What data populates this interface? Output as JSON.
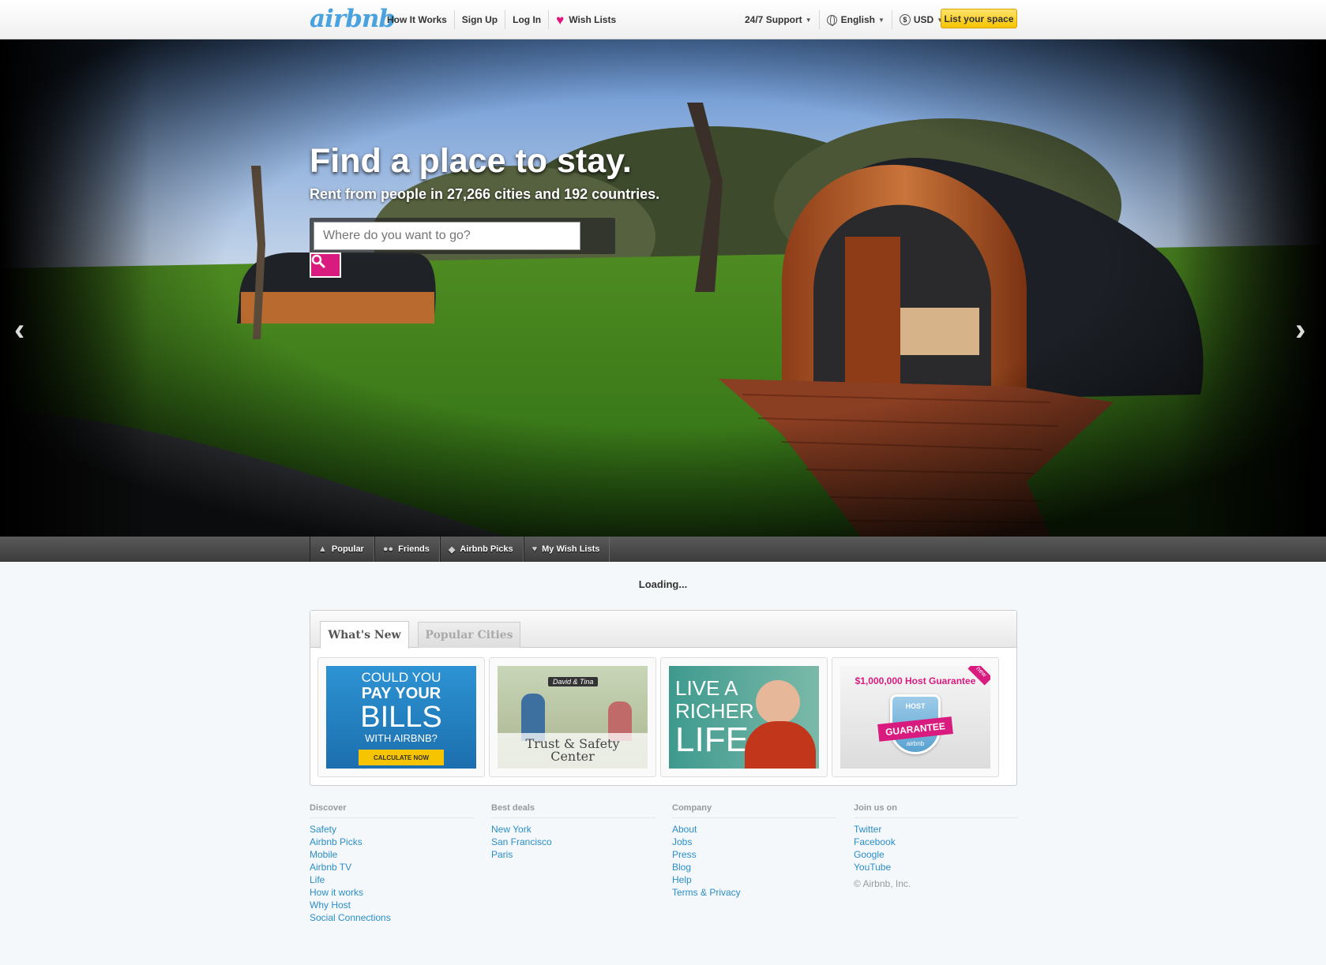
{
  "header": {
    "logo": "airbnb",
    "nav_left": [
      "How It Works",
      "Sign Up",
      "Log In"
    ],
    "wish_lists": "Wish Lists",
    "support": "24/7 Support",
    "language": "English",
    "currency": "USD",
    "list_space": "List your space"
  },
  "hero": {
    "title": "Find a place to stay.",
    "subtitle": "Rent from people in 27,266 cities and 192 countries.",
    "search_placeholder": "Where do you want to go?"
  },
  "explore_tabs": [
    "Popular",
    "Friends",
    "Airbnb Picks",
    "My Wish Lists"
  ],
  "loading_text": "Loading...",
  "panel": {
    "tabs": [
      "What's New",
      "Popular Cities"
    ],
    "active_tab": "What's New",
    "cards": [
      {
        "lines": [
          "COULD YOU",
          "PAY YOUR",
          "BILLS",
          "WITH AIRBNB?"
        ],
        "cta": "CALCULATE NOW"
      },
      {
        "tag": "David & Tina",
        "caption": [
          "Trust & Safety",
          "Center"
        ]
      },
      {
        "lines": [
          "LIVE A",
          "RICHER",
          "LIFE"
        ]
      },
      {
        "title": "$1,000,000 Host Guarantee",
        "corner": "new",
        "badge_top": "HOST",
        "badge_main": "GUARANTEE",
        "badge_sub": "airbnb"
      }
    ]
  },
  "footer": {
    "columns": [
      {
        "heading": "Discover",
        "links": [
          "Safety",
          "Airbnb Picks",
          "Mobile",
          "Airbnb TV",
          "Life",
          "How it works",
          "Why Host",
          "Social Connections"
        ]
      },
      {
        "heading": "Best deals",
        "links": [
          "New York",
          "San Francisco",
          "Paris"
        ]
      },
      {
        "heading": "Company",
        "links": [
          "About",
          "Jobs",
          "Press",
          "Blog",
          "Help",
          "Terms & Privacy"
        ]
      },
      {
        "heading": "Join us on",
        "links": [
          "Twitter",
          "Facebook",
          "Google",
          "YouTube"
        ]
      }
    ],
    "copyright": "© Airbnb, Inc."
  },
  "colors": {
    "brand_blue": "#4aa3df",
    "accent_pink": "#d91b7f",
    "list_button": "#f6c400",
    "link": "#2b8ec8"
  }
}
